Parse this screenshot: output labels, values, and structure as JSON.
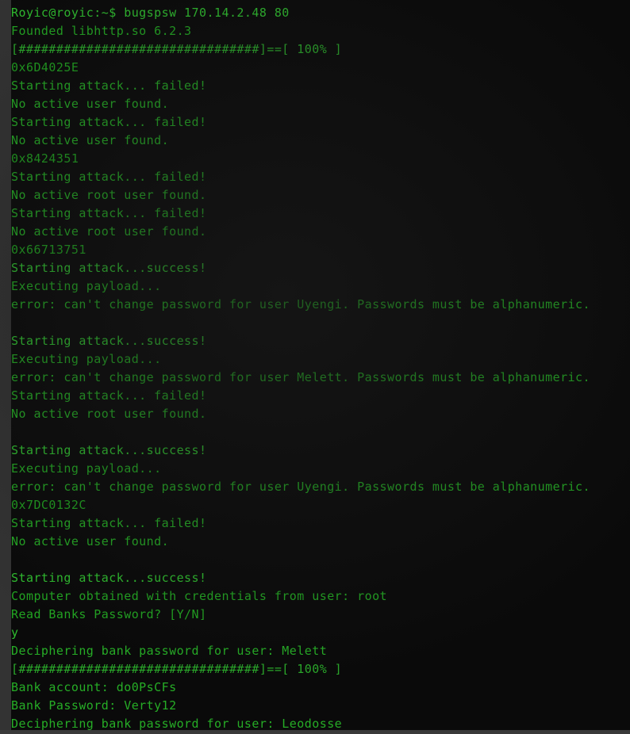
{
  "window": {
    "title": "Terminal",
    "background_color": "#0a0a0a",
    "text_color": "#22a522",
    "gutter_color": "#333333",
    "bottom_bar_color": "#3a3a3a"
  },
  "shell": {
    "user": "Royic",
    "host": "royic",
    "cwd": "~",
    "symbol": "$",
    "prompt": "Royic@royic:~$",
    "command": "bugspsw 170.14.2.48 80",
    "target_ip": "170.14.2.48",
    "target_port": "80"
  },
  "progress_bar": {
    "filled": "[################################]",
    "separator": "==",
    "percent_block": "[ 100% ]",
    "percent": 100
  },
  "terminal": {
    "lines": [
      {
        "kind": "prompt",
        "text": "Royic@royic:~$ bugspsw 170.14.2.48 80"
      },
      {
        "kind": "info",
        "text": "Founded libhttp.so 6.2.3"
      },
      {
        "kind": "progress",
        "text": "[################################]==[ 100% ]"
      },
      {
        "kind": "addr",
        "text": "0x6D4025E"
      },
      {
        "kind": "fail",
        "text": "Starting attack... failed!"
      },
      {
        "kind": "fail",
        "text": "No active user found."
      },
      {
        "kind": "fail",
        "text": "Starting attack... failed!"
      },
      {
        "kind": "fail",
        "text": "No active user found."
      },
      {
        "kind": "addr",
        "text": "0x8424351"
      },
      {
        "kind": "fail",
        "text": "Starting attack... failed!"
      },
      {
        "kind": "fail",
        "text": "No active root user found."
      },
      {
        "kind": "fail",
        "text": "Starting attack... failed!"
      },
      {
        "kind": "fail",
        "text": "No active root user found."
      },
      {
        "kind": "addr",
        "text": "0x66713751"
      },
      {
        "kind": "success",
        "text": "Starting attack...success!"
      },
      {
        "kind": "info",
        "text": "Executing payload..."
      },
      {
        "kind": "error",
        "text": "error: can't change password for user Uyengi. Passwords must be alphanumeric."
      },
      {
        "kind": "blank",
        "text": ""
      },
      {
        "kind": "success",
        "text": "Starting attack...success!"
      },
      {
        "kind": "info",
        "text": "Executing payload..."
      },
      {
        "kind": "error",
        "text": "error: can't change password for user Melett. Passwords must be alphanumeric."
      },
      {
        "kind": "fail",
        "text": "Starting attack... failed!"
      },
      {
        "kind": "fail",
        "text": "No active root user found."
      },
      {
        "kind": "blank",
        "text": ""
      },
      {
        "kind": "success",
        "text": "Starting attack...success!"
      },
      {
        "kind": "info",
        "text": "Executing payload..."
      },
      {
        "kind": "error",
        "text": "error: can't change password for user Uyengi. Passwords must be alphanumeric."
      },
      {
        "kind": "addr",
        "text": "0x7DC0132C"
      },
      {
        "kind": "fail",
        "text": "Starting attack... failed!"
      },
      {
        "kind": "fail",
        "text": "No active user found."
      },
      {
        "kind": "blank",
        "text": ""
      },
      {
        "kind": "success",
        "text": "Starting attack...success!"
      },
      {
        "kind": "info",
        "text": "Computer obtained with credentials from user: root"
      },
      {
        "kind": "info",
        "text": "Read Banks Password? [Y/N]"
      },
      {
        "kind": "input",
        "text": "y"
      },
      {
        "kind": "bank",
        "text": "Deciphering bank password for user: Melett"
      },
      {
        "kind": "progress",
        "text": "[################################]==[ 100% ]"
      },
      {
        "kind": "bank",
        "text": "Bank account: do0PsCFs"
      },
      {
        "kind": "bank",
        "text": "Bank Password: Verty12"
      },
      {
        "kind": "bank",
        "text": "Deciphering bank password for user: Leodosse"
      }
    ]
  },
  "extracted": {
    "memory_addresses": [
      "0x6D4025E",
      "0x8424351",
      "0x66713751",
      "0x7DC0132C"
    ],
    "users": [
      "Uyengi",
      "Melett",
      "root",
      "Leodosse"
    ],
    "bank_account": "do0PsCFs",
    "bank_password": "Verty12",
    "library": "libhttp.so 6.2.3",
    "confirm_answer": "y"
  }
}
